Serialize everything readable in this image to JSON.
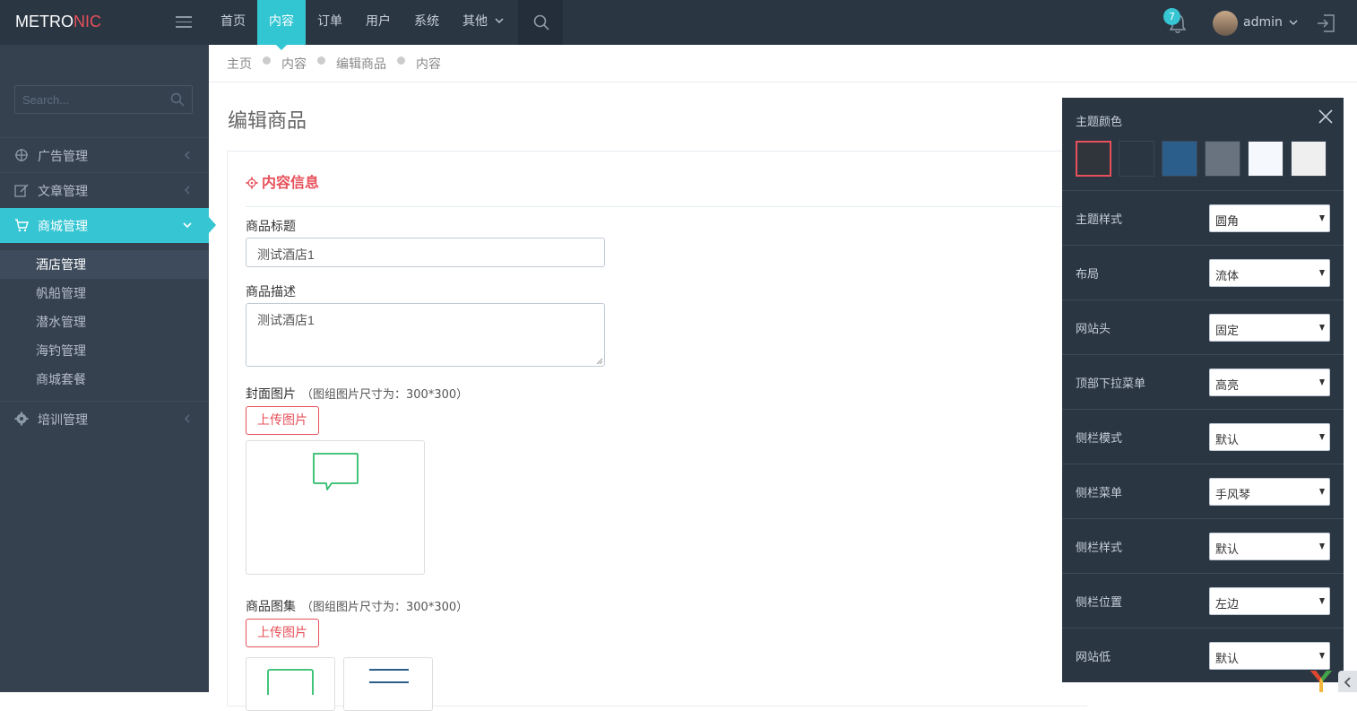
{
  "header": {
    "logo_main": "METRO",
    "logo_accent": "NIC",
    "nav": [
      "首页",
      "内容",
      "订单",
      "用户",
      "系统",
      "其他"
    ],
    "active_nav": "内容",
    "notification_count": "7",
    "username": "admin"
  },
  "sidebar": {
    "search_placeholder": "Search...",
    "items": [
      {
        "label": "广告管理",
        "icon": "crosshair-icon"
      },
      {
        "label": "文章管理",
        "icon": "edit-icon"
      },
      {
        "label": "商城管理",
        "icon": "cart-icon"
      },
      {
        "label": "培训管理",
        "icon": "settings-icon"
      }
    ],
    "subitems": [
      "酒店管理",
      "帆船管理",
      "潜水管理",
      "海钓管理",
      "商城套餐"
    ],
    "active_item": "商城管理",
    "active_subitem": "酒店管理"
  },
  "breadcrumb": [
    "主页",
    "内容",
    "编辑商品",
    "内容"
  ],
  "page": {
    "title": "编辑商品",
    "section_title": "内容信息",
    "fields": {
      "title_label": "商品标题",
      "title_value": "测试酒店1",
      "desc_label": "商品描述",
      "desc_value": "测试酒店1",
      "cover_label": "封面图片",
      "cover_hint": "（图组图片尺寸为：300*300）",
      "gallery_label": "商品图集",
      "gallery_hint": "（图组图片尺寸为：300*300）",
      "upload_label": "上传图片"
    }
  },
  "theme_panel": {
    "title": "主题颜色",
    "swatches": [
      "#2f353b",
      "#2b3643",
      "#2c5e8c",
      "#697380",
      "#f5f8fc",
      "#efefef"
    ],
    "selected_swatch": 0,
    "rows": [
      {
        "label": "主题样式",
        "value": "圆角"
      },
      {
        "label": "布局",
        "value": "流体"
      },
      {
        "label": "网站头",
        "value": "固定"
      },
      {
        "label": "顶部下拉菜单",
        "value": "高亮"
      },
      {
        "label": "侧栏模式",
        "value": "默认"
      },
      {
        "label": "侧栏菜单",
        "value": "手风琴"
      },
      {
        "label": "侧栏样式",
        "value": "默认"
      },
      {
        "label": "侧栏位置",
        "value": "左边"
      },
      {
        "label": "网站低",
        "value": "默认"
      }
    ]
  },
  "colors": {
    "topbar": "#2b3643",
    "sidebar": "#364150",
    "accent": "#32c5d2",
    "danger": "#e7505a"
  }
}
